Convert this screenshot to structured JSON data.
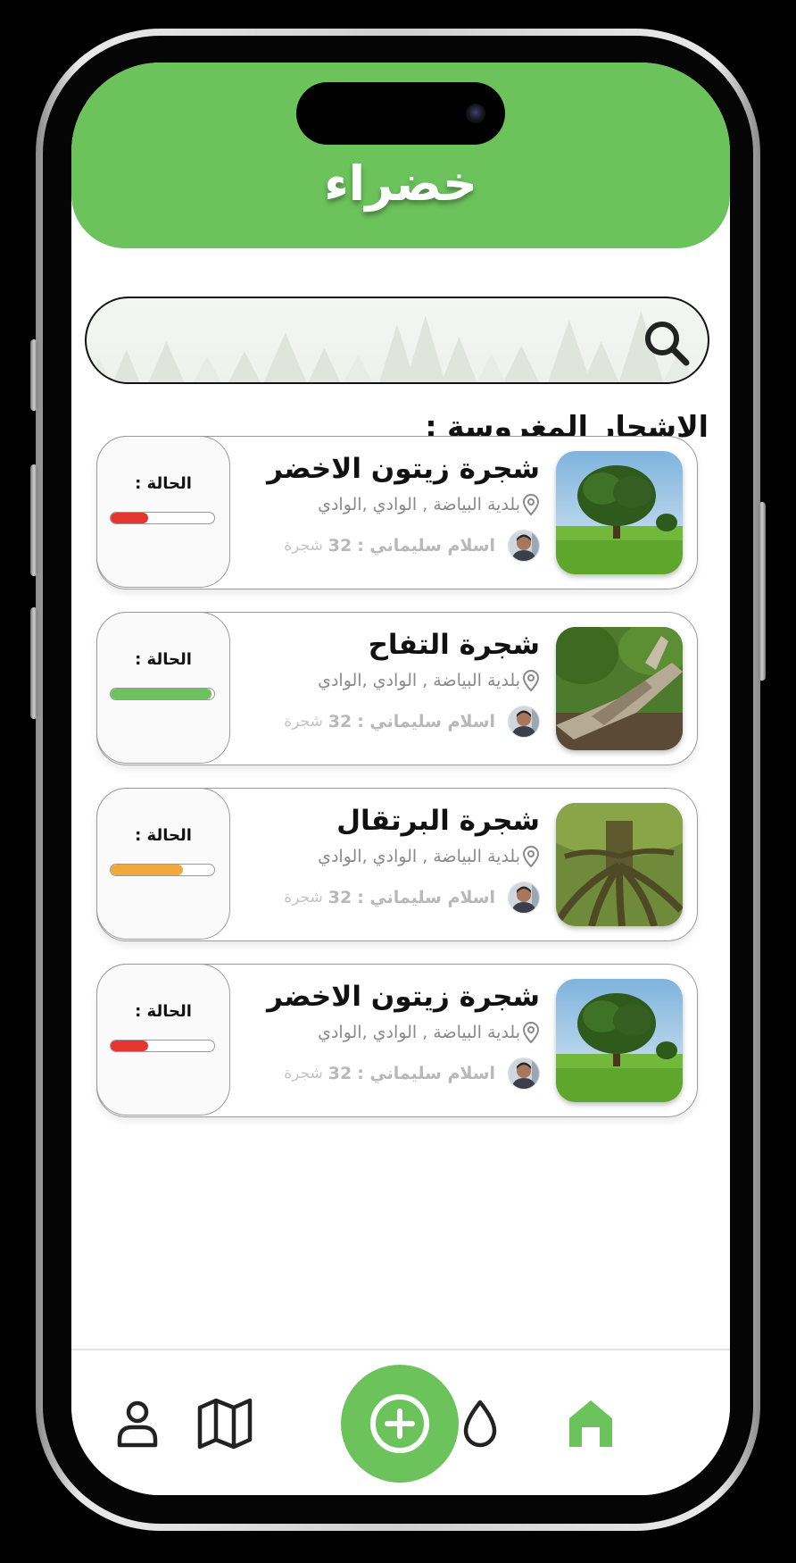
{
  "app": {
    "title": "خضراء"
  },
  "search": {
    "placeholder": ""
  },
  "section": {
    "title": "الاشجار المغروسة :"
  },
  "cards": [
    {
      "name": "شجرة زيتون الاخضر",
      "location": "بلدية البياضة , الوادي ,الوادي",
      "planter": "اسلام سليماني :",
      "count": "32",
      "unit": "شجرة",
      "status_label": "الحالة :",
      "status_level": 0.36,
      "status_color": "#e53530",
      "image": "green-field-oak-tree"
    },
    {
      "name": "شجرة التفاح",
      "location": "بلدية البياضة , الوادي ,الوادي",
      "planter": "اسلام سليماني :",
      "count": "32",
      "unit": "شجرة",
      "status_label": "الحالة :",
      "status_level": 0.97,
      "status_color": "#6cc35c",
      "image": "fallen-tree-trunk"
    },
    {
      "name": "شجرة البرتقال",
      "location": "بلدية البياضة , الوادي ,الوادي",
      "planter": "اسلام سليماني :",
      "count": "32",
      "unit": "شجرة",
      "status_label": "الحالة :",
      "status_level": 0.7,
      "status_color": "#f2a93b",
      "image": "tree-roots"
    },
    {
      "name": "شجرة زيتون الاخضر",
      "location": "بلدية البياضة , الوادي ,الوادي",
      "planter": "اسلام سليماني :",
      "count": "32",
      "unit": "شجرة",
      "status_label": "الحالة :",
      "status_level": 0.36,
      "status_color": "#e53530",
      "image": "green-field-oak-tree"
    }
  ],
  "nav": {
    "items": [
      {
        "icon": "home-icon",
        "active": true
      },
      {
        "icon": "water-drop-icon",
        "active": false
      },
      {
        "icon": "add-icon",
        "active": false
      },
      {
        "icon": "map-icon",
        "active": false
      },
      {
        "icon": "profile-icon",
        "active": false
      }
    ]
  },
  "colors": {
    "accent": "#6cc35c",
    "text": "#111111",
    "muted": "#8a8a8a"
  }
}
